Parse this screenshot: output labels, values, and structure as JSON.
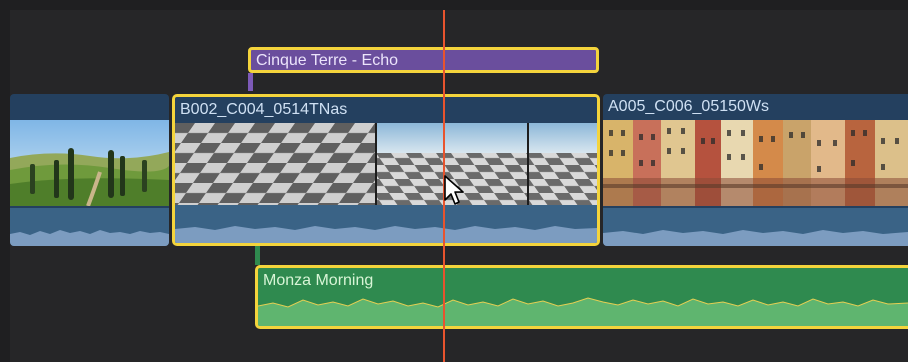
{
  "timeline": {
    "title_clip": {
      "label": "Cinque Terre - Echo"
    },
    "video_clips": [
      {
        "label": ""
      },
      {
        "label": "B002_C004_0514TNas"
      },
      {
        "label": "A005_C006_05150Ws"
      }
    ],
    "audio_clip": {
      "label": "Monza Morning"
    }
  },
  "colors": {
    "selection": "#f4d43c",
    "playhead": "#e8542e",
    "title_clip": "#6a4e9d",
    "video_clip": "#24405f",
    "audio_clip": "#2f8a4f"
  },
  "icons": {
    "cursor": "arrow-pointer-icon"
  }
}
